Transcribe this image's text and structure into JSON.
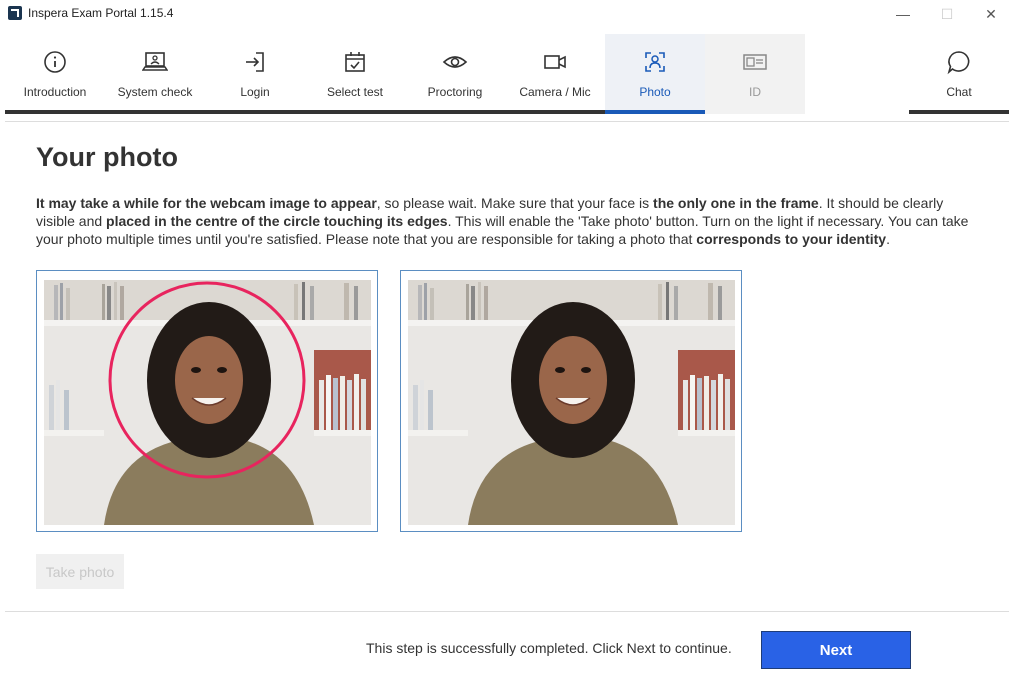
{
  "window": {
    "title": "Inspera Exam Portal 1.15.4",
    "minimize": "—",
    "maximize": "☐",
    "close": "✕"
  },
  "nav": {
    "items": [
      {
        "label": "Introduction",
        "icon": "info-icon"
      },
      {
        "label": "System check",
        "icon": "laptop-icon"
      },
      {
        "label": "Login",
        "icon": "login-icon"
      },
      {
        "label": "Select test",
        "icon": "calendar-check-icon"
      },
      {
        "label": "Proctoring",
        "icon": "eye-icon"
      },
      {
        "label": "Camera / Mic",
        "icon": "video-camera-icon"
      },
      {
        "label": "Photo",
        "icon": "face-scan-icon",
        "state": "active"
      },
      {
        "label": "ID",
        "icon": "id-card-icon",
        "state": "disabled"
      }
    ],
    "chat": {
      "label": "Chat",
      "icon": "chat-bubble-icon"
    },
    "active_color": "#1a5ab8"
  },
  "main": {
    "heading": "Your photo",
    "instructions": {
      "p1_bold": "It may take a while for the webcam image to appear",
      "p2": ", so please wait. Make sure that your face is ",
      "p3_bold": "the only one in the frame",
      "p4": ". It should be clearly visible and ",
      "p5_bold": "placed in the centre of the circle touching its edges",
      "p6": ". This will enable the 'Take photo' button. Turn on the light if necessary. You can take your photo multiple times until you're satisfied. Please note that you are responsible for taking a photo that ",
      "p7_bold": "corresponds to your identity",
      "p8": "."
    },
    "live_camera_guide_color": "#e8245e",
    "take_photo_label": "Take photo"
  },
  "footer": {
    "status": "This step is successfully completed. Click Next to continue.",
    "next_label": "Next"
  }
}
